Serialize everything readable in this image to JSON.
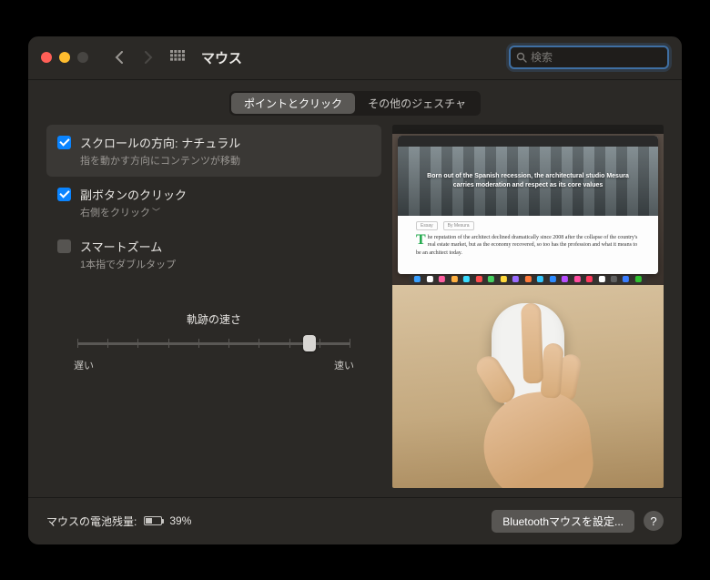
{
  "window": {
    "title": "マウス"
  },
  "search": {
    "placeholder": "検索"
  },
  "tabs": [
    {
      "label": "ポイントとクリック",
      "active": true
    },
    {
      "label": "その他のジェスチャ",
      "active": false
    }
  ],
  "options": [
    {
      "title": "スクロールの方向: ナチュラル",
      "subtitle": "指を動かす方向にコンテンツが移動",
      "checked": true,
      "selected": true,
      "has_submenu": false
    },
    {
      "title": "副ボタンのクリック",
      "subtitle": "右側をクリック",
      "checked": true,
      "selected": false,
      "has_submenu": true
    },
    {
      "title": "スマートズーム",
      "subtitle": "1本指でダブルタップ",
      "checked": false,
      "selected": false,
      "has_submenu": false
    }
  ],
  "slider": {
    "label": "軌跡の速さ",
    "min_label": "遅い",
    "max_label": "速い",
    "ticks": 10,
    "value_pct": 85
  },
  "preview": {
    "hero_text": "Born out of the Spanish recession, the architectural studio Mesura carries moderation and respect as its core values",
    "article_text": "he reputation of the architect declined dramatically since 2008 after the collapse of the country's real estate market, but as the economy recovered, so too has the profession and what it means to be an architect today.",
    "tag1": "Essay",
    "tag2": "By Mesura",
    "dock_colors": [
      "#3aa0ff",
      "#ffffff",
      "#ff5ea0",
      "#ffb040",
      "#3adcff",
      "#ff4d4d",
      "#46d160",
      "#ffd83a",
      "#9a6bff",
      "#ff7a3a",
      "#34c8ff",
      "#2d8bff",
      "#b84dff",
      "#ff4da0",
      "#ff3a5e",
      "#ffffff",
      "#606060",
      "#3a7dff",
      "#30c030"
    ]
  },
  "footer": {
    "battery_label": "マウスの電池残量:",
    "battery_pct": "39%",
    "bluetooth_button": "Bluetoothマウスを設定...",
    "help": "?"
  }
}
